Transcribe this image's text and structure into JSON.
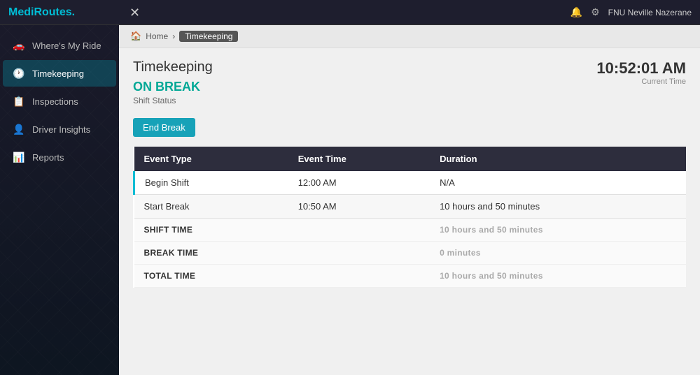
{
  "app": {
    "logo_text": "MediR",
    "logo_highlight": "outes",
    "logo_dot": ".",
    "close_icon": "✕",
    "user_name": "FNU Neville Nazerane"
  },
  "sidebar": {
    "items": [
      {
        "id": "wheres-my-ride",
        "label": "Where's My Ride",
        "icon": "🚗",
        "active": false
      },
      {
        "id": "timekeeping",
        "label": "Timekeeping",
        "icon": "🕐",
        "active": true
      },
      {
        "id": "inspections",
        "label": "Inspections",
        "icon": "📋",
        "active": false
      },
      {
        "id": "driver-insights",
        "label": "Driver Insights",
        "icon": "👤",
        "active": false
      },
      {
        "id": "reports",
        "label": "Reports",
        "icon": "📊",
        "active": false
      }
    ]
  },
  "breadcrumb": {
    "home_icon": "🏠",
    "home_label": "Home",
    "current": "Timekeeping"
  },
  "page": {
    "title": "Timekeeping",
    "status": "ON BREAK",
    "shift_status_label": "Shift Status",
    "current_time": "10:52:01 AM",
    "current_time_label": "Current Time",
    "end_break_button": "End Break"
  },
  "table": {
    "columns": [
      "Event Type",
      "Event Time",
      "Duration"
    ],
    "rows": [
      {
        "event_type": "Begin Shift",
        "event_time": "12:00 AM",
        "duration": "N/A",
        "accent": true
      },
      {
        "event_type": "Start Break",
        "event_time": "10:50 AM",
        "duration": "10 hours and 50 minutes",
        "accent": false
      }
    ],
    "summary": [
      {
        "label": "SHIFT TIME",
        "value": "10 hours and 50 minutes"
      },
      {
        "label": "BREAK TIME",
        "value": "0 minutes"
      },
      {
        "label": "TOTAL TIME",
        "value": "10 hours and 50 minutes"
      }
    ]
  },
  "icons": {
    "settings": "⚙",
    "notifications": "🔔",
    "chevron_right": "›"
  }
}
